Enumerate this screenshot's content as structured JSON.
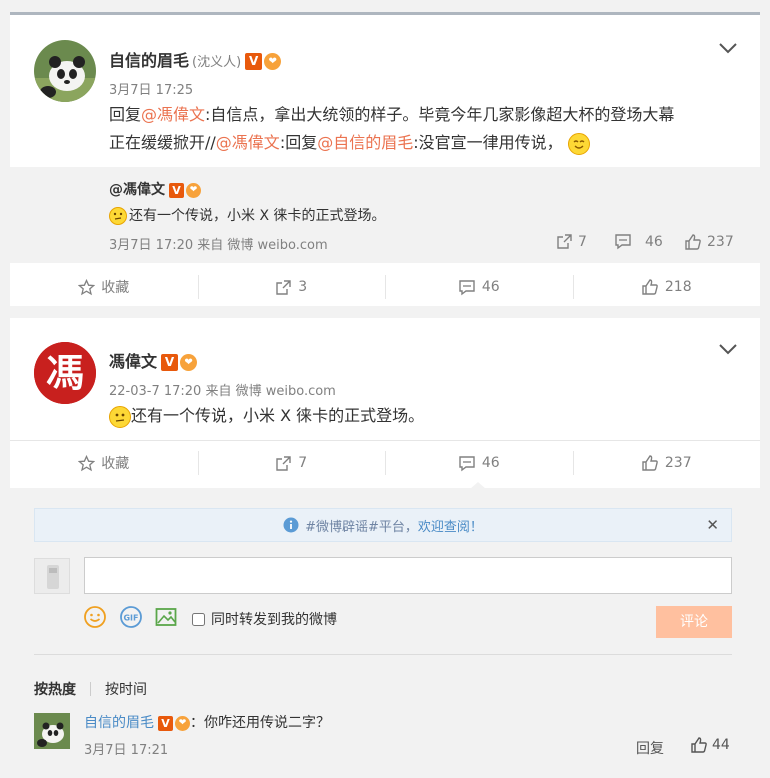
{
  "post1": {
    "user_name": "自信的眉毛",
    "user_remark": "(沈义人)",
    "time": "3月7日 17:25",
    "text_prefix": "回复",
    "mention1": "@馮偉文",
    "text_part1": ":自信点，拿出大统领的样子。毕竟今年几家影像超大杯的登场大幕",
    "text_part2": "正在缓缓掀开//",
    "mention2": "@馮偉文",
    "text_part3": ":回复",
    "mention3": "@自信的眉毛",
    "text_part4": ":没官宣一律用传说，",
    "repost": {
      "user": "@馮偉文",
      "text": "还有一个传说，小米 X 徕卡的正式登场。",
      "time_source": "3月7日 17:20 来自 微博 weibo.com",
      "forwards": "7",
      "comments": "46",
      "likes": "237"
    },
    "actions": {
      "favorite": "收藏",
      "forwards": "3",
      "comments": "46",
      "likes": "218"
    }
  },
  "post2": {
    "user_name": "馮偉文",
    "avatar_char": "馮",
    "time_source": "22-03-7 17:20 来自 微博 weibo.com",
    "text": "还有一个传说，小米 X 徕卡的正式登场。",
    "actions": {
      "favorite": "收藏",
      "forwards": "7",
      "comments": "46",
      "likes": "237"
    },
    "comment_area": {
      "notice_text": "#微博辟谣#平台，",
      "notice_link": "欢迎查阅！",
      "forward_checkbox_label": "同时转发到我的微博",
      "submit_label": "评论",
      "sort_hot": "按热度",
      "sort_time": "按时间",
      "comment": {
        "user": "自信的眉毛",
        "text": "：你咋还用传说二字？",
        "time": "3月7日 17:21",
        "reply_label": "回复",
        "likes": "44"
      }
    }
  },
  "colors": {
    "link": "#eb7350",
    "blue_link": "#4a8bc6",
    "submit_disabled": "#ffc09f",
    "badge_v": "#e8590c"
  }
}
